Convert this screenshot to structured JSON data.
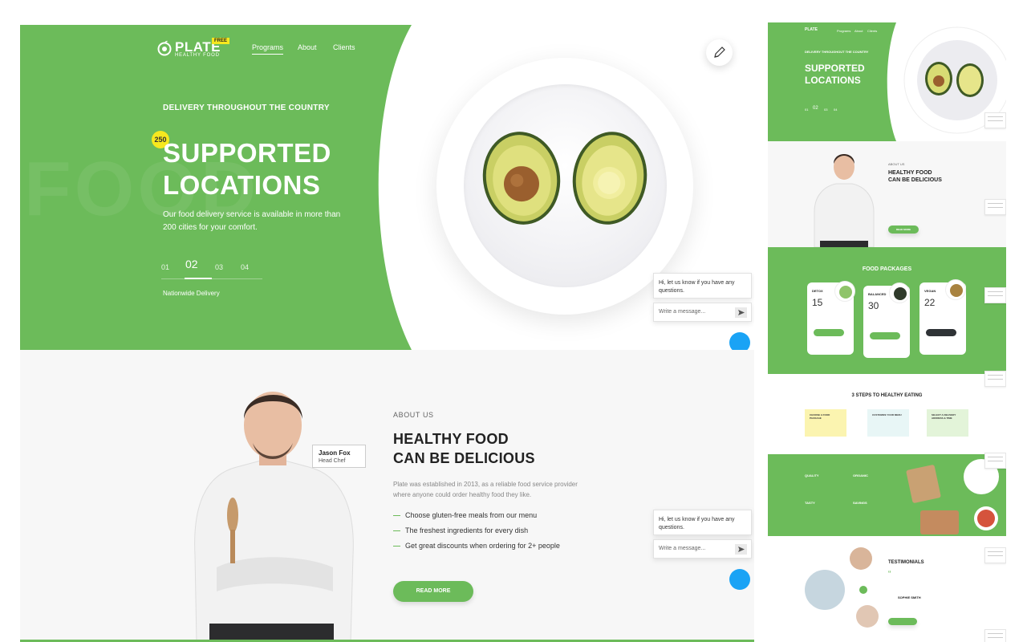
{
  "colors": {
    "brand_green": "#6cbb5a",
    "accent_yellow": "#f6e81f",
    "chat_blue": "#1aa3f5",
    "text_dark": "#222222"
  },
  "brand": {
    "name": "PLATE",
    "tagline": "HEALTHY FOOD",
    "badge": "FREE"
  },
  "nav": {
    "items": [
      "Programs",
      "About",
      "Clients"
    ],
    "active": "Programs"
  },
  "hero": {
    "eyebrow": "DELIVERY THROUGHOUT THE COUNTRY",
    "count_badge": "250",
    "title_line1": "SUPPORTED",
    "title_line2": "LOCATIONS",
    "description": "Our food delivery service is available in more than 200 cities for your comfort.",
    "background_word": "FOOD",
    "slides": [
      "01",
      "02",
      "03",
      "04"
    ],
    "active_slide": "02",
    "slide_caption": "Nationwide Delivery",
    "edit_icon": "pencil-icon"
  },
  "chat": {
    "message": "Hi, let us know if you have any questions.",
    "placeholder": "Write a message...",
    "send_icon": "send-arrow-icon"
  },
  "about": {
    "eyebrow": "ABOUT US",
    "title_line1": "HEALTHY FOOD",
    "title_line2": "CAN BE DELICIOUS",
    "description": "Plate was established in 2013, as a reliable food service provider where anyone could order healthy food they like.",
    "list": [
      "Choose gluten-free meals from our menu",
      "The freshest ingredients for every dish",
      "Get great discounts when ordering for 2+ people"
    ],
    "button": "READ MORE",
    "chef_name": "Jason Fox",
    "chef_role": "Head Chef"
  },
  "thumbs": {
    "hero": {
      "eyebrow": "DELIVERY THROUGHOUT THE COUNTRY",
      "title_line1": "SUPPORTED",
      "title_line2": "LOCATIONS",
      "nav": [
        "Programs",
        "About",
        "Clients"
      ],
      "slides": [
        "01",
        "02",
        "03",
        "04"
      ]
    },
    "about": {
      "eyebrow": "ABOUT US",
      "title_line1": "HEALTHY FOOD",
      "title_line2": "CAN BE DELICIOUS",
      "button": "READ MORE"
    },
    "packages": {
      "title": "FOOD PACKAGES",
      "items": [
        {
          "name": "DETOX",
          "price": "15"
        },
        {
          "name": "BALANCED",
          "price": "30"
        },
        {
          "name": "VEGAN",
          "price": "22"
        }
      ]
    },
    "steps": {
      "title": "3 STEPS TO HEALTHY EATING",
      "items": [
        "CHOOSE A FOOD PACKAGE",
        "CUSTOMIZE YOUR MENU",
        "SELECT A DELIVERY ADDRESS & TIME"
      ]
    },
    "features": [
      "QUALITY",
      "ORGANIC",
      "TASTY",
      "SAVINGS"
    ],
    "testimonials": {
      "title": "TESTIMONIALS",
      "author": "SOPHIE SMITH"
    }
  }
}
